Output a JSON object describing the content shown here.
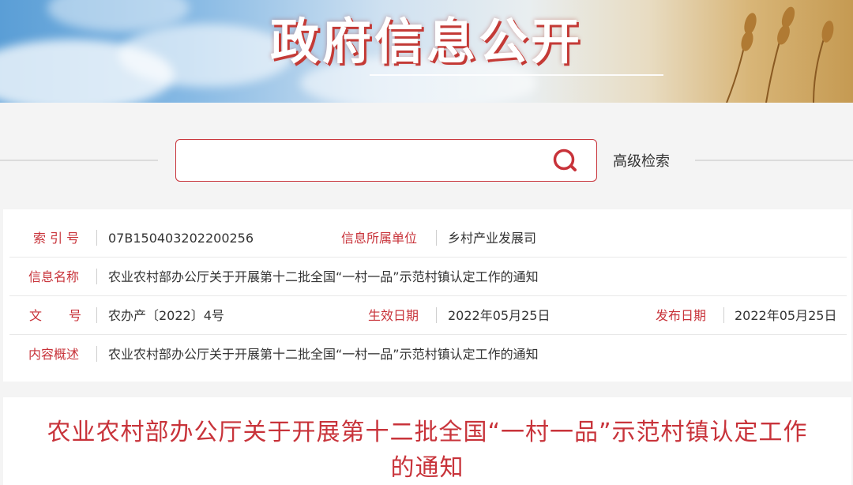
{
  "banner": {
    "title": "政府信息公开"
  },
  "search": {
    "placeholder": "",
    "value": "",
    "advanced_label": "高级检索"
  },
  "meta": {
    "index_label": "索 引 号",
    "index_value": "07B150403202200256",
    "unit_label": "信息所属单位",
    "unit_value": "乡村产业发展司",
    "name_label": "信息名称",
    "name_value": "农业农村部办公厅关于开展第十二批全国“一村一品”示范村镇认定工作的通知",
    "doc_label_a": "文",
    "doc_label_b": "号",
    "doc_value": "农办产〔2022〕4号",
    "effective_label": "生效日期",
    "effective_value": "2022年05月25日",
    "publish_label": "发布日期",
    "publish_value": "2022年05月25日",
    "summary_label": "内容概述",
    "summary_value": "农业农村部办公厅关于开展第十二批全国“一村一品”示范村镇认定工作的通知"
  },
  "article": {
    "title": "农业农村部办公厅关于开展第十二批全国“一村一品”示范村镇认定工作的通知"
  },
  "colors": {
    "accent": "#c8333a",
    "text": "#333333",
    "background": "#f4f4f4"
  }
}
